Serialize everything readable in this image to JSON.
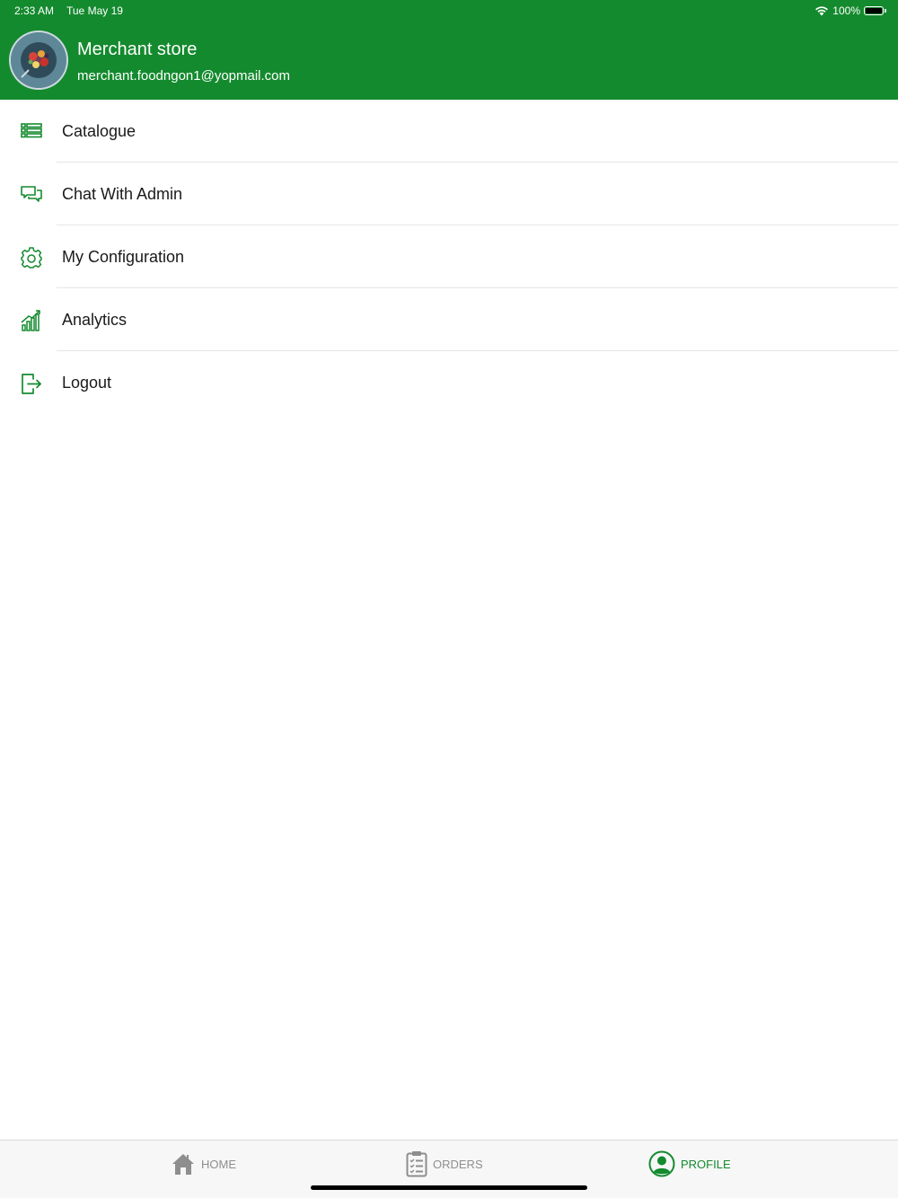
{
  "status_bar": {
    "time": "2:33 AM",
    "date": "Tue May 19",
    "battery_text": "100%"
  },
  "header": {
    "store_name": "Merchant store",
    "email": "merchant.foodngon1@yopmail.com",
    "background_color": "#148a2e"
  },
  "menu": {
    "items": [
      {
        "label": "Catalogue",
        "icon": "list-icon"
      },
      {
        "label": "Chat With Admin",
        "icon": "chat-icon"
      },
      {
        "label": "My Configuration",
        "icon": "gear-icon"
      },
      {
        "label": "Analytics",
        "icon": "analytics-chart-icon"
      },
      {
        "label": "Logout",
        "icon": "logout-icon"
      }
    ],
    "icon_color": "#148a2e"
  },
  "tabbar": {
    "tabs": [
      {
        "label": "HOME",
        "icon": "home-icon",
        "active": false
      },
      {
        "label": "ORDERS",
        "icon": "clipboard-icon",
        "active": false
      },
      {
        "label": "PROFILE",
        "icon": "profile-icon",
        "active": true
      }
    ],
    "active_color": "#148a2e",
    "inactive_color": "#8e8e8e"
  }
}
